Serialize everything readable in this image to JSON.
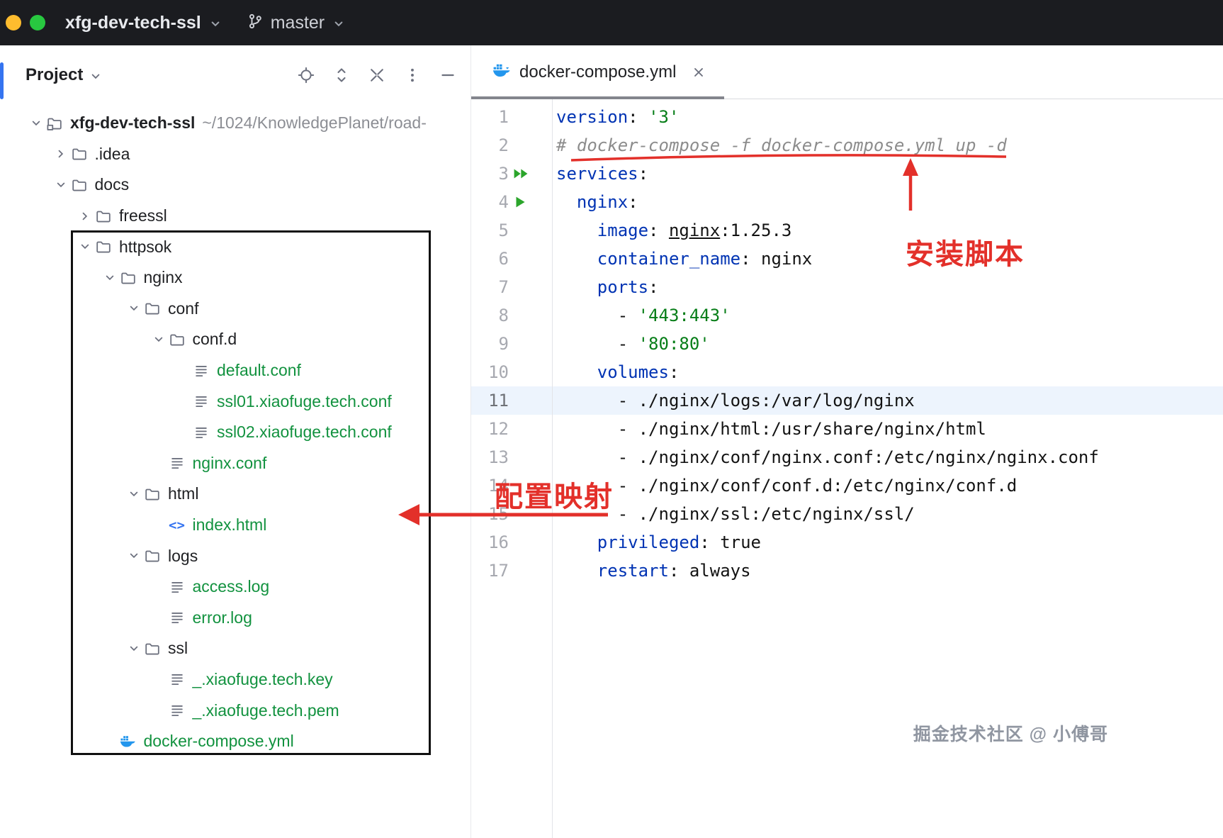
{
  "titlebar": {
    "project_name": "xfg-dev-tech-ssl",
    "branch": "master"
  },
  "project_panel": {
    "title": "Project",
    "tree": [
      {
        "label": "xfg-dev-tech-ssl",
        "suffix": " ~/1024/KnowledgePlanet/road-",
        "indent": 0,
        "icon": "project_folder",
        "chevron": "down",
        "color": "dark",
        "bold": true
      },
      {
        "label": ".idea",
        "indent": 1,
        "icon": "folder",
        "chevron": "right",
        "color": "dark"
      },
      {
        "label": "docs",
        "indent": 1,
        "icon": "folder",
        "chevron": "down",
        "color": "dark"
      },
      {
        "label": "freessl",
        "indent": 2,
        "icon": "folder",
        "chevron": "right",
        "color": "dark"
      },
      {
        "label": "httpsok",
        "indent": 2,
        "icon": "folder",
        "chevron": "down",
        "color": "dark"
      },
      {
        "label": "nginx",
        "indent": 3,
        "icon": "folder",
        "chevron": "down",
        "color": "dark"
      },
      {
        "label": "conf",
        "indent": 4,
        "icon": "folder",
        "chevron": "down",
        "color": "dark"
      },
      {
        "label": "conf.d",
        "indent": 5,
        "icon": "folder",
        "chevron": "down",
        "color": "dark"
      },
      {
        "label": "default.conf",
        "indent": 6,
        "icon": "file",
        "chevron": "none",
        "color": "green"
      },
      {
        "label": "ssl01.xiaofuge.tech.conf",
        "indent": 6,
        "icon": "file",
        "chevron": "none",
        "color": "green"
      },
      {
        "label": "ssl02.xiaofuge.tech.conf",
        "indent": 6,
        "icon": "file",
        "chevron": "none",
        "color": "green"
      },
      {
        "label": "nginx.conf",
        "indent": 5,
        "icon": "file",
        "chevron": "none",
        "color": "green"
      },
      {
        "label": "html",
        "indent": 4,
        "icon": "folder",
        "chevron": "down",
        "color": "dark"
      },
      {
        "label": "index.html",
        "indent": 5,
        "icon": "html",
        "chevron": "none",
        "color": "green"
      },
      {
        "label": "logs",
        "indent": 4,
        "icon": "folder",
        "chevron": "down",
        "color": "dark"
      },
      {
        "label": "access.log",
        "indent": 5,
        "icon": "file",
        "chevron": "none",
        "color": "green"
      },
      {
        "label": "error.log",
        "indent": 5,
        "icon": "file",
        "chevron": "none",
        "color": "green"
      },
      {
        "label": "ssl",
        "indent": 4,
        "icon": "folder",
        "chevron": "down",
        "color": "dark"
      },
      {
        "label": "_.xiaofuge.tech.key",
        "indent": 5,
        "icon": "file",
        "chevron": "none",
        "color": "green"
      },
      {
        "label": "_.xiaofuge.tech.pem",
        "indent": 5,
        "icon": "file",
        "chevron": "none",
        "color": "green"
      },
      {
        "label": "docker-compose.yml",
        "indent": 3,
        "icon": "docker",
        "chevron": "none",
        "color": "green"
      }
    ]
  },
  "editor": {
    "tab": {
      "title": "docker-compose.yml"
    },
    "lines": [
      {
        "n": 1,
        "tokens": [
          {
            "t": "version",
            "c": "key"
          },
          {
            "t": ": ",
            "c": "p"
          },
          {
            "t": "'3'",
            "c": "str"
          }
        ]
      },
      {
        "n": 2,
        "tokens": [
          {
            "t": "# docker-compose -f docker-compose.yml up -d",
            "c": "com"
          }
        ]
      },
      {
        "n": 3,
        "run": "double",
        "tokens": [
          {
            "t": "services",
            "c": "key"
          },
          {
            "t": ":",
            "c": "p"
          }
        ]
      },
      {
        "n": 4,
        "run": "single",
        "tokens": [
          {
            "t": "  ",
            "c": "p"
          },
          {
            "t": "nginx",
            "c": "key"
          },
          {
            "t": ":",
            "c": "p"
          }
        ]
      },
      {
        "n": 5,
        "tokens": [
          {
            "t": "    ",
            "c": "p"
          },
          {
            "t": "image",
            "c": "key"
          },
          {
            "t": ": ",
            "c": "p"
          },
          {
            "t": "nginx",
            "c": "txt u"
          },
          {
            "t": ":1.25.3",
            "c": "txt"
          }
        ]
      },
      {
        "n": 6,
        "tokens": [
          {
            "t": "    ",
            "c": "p"
          },
          {
            "t": "container_name",
            "c": "key"
          },
          {
            "t": ": ",
            "c": "p"
          },
          {
            "t": "nginx",
            "c": "txt"
          }
        ]
      },
      {
        "n": 7,
        "tokens": [
          {
            "t": "    ",
            "c": "p"
          },
          {
            "t": "ports",
            "c": "key"
          },
          {
            "t": ":",
            "c": "p"
          }
        ]
      },
      {
        "n": 8,
        "tokens": [
          {
            "t": "      - ",
            "c": "p"
          },
          {
            "t": "'443:443'",
            "c": "str"
          }
        ]
      },
      {
        "n": 9,
        "tokens": [
          {
            "t": "      - ",
            "c": "p"
          },
          {
            "t": "'80:80'",
            "c": "str"
          }
        ]
      },
      {
        "n": 10,
        "tokens": [
          {
            "t": "    ",
            "c": "p"
          },
          {
            "t": "volumes",
            "c": "key"
          },
          {
            "t": ":",
            "c": "p"
          }
        ]
      },
      {
        "n": 11,
        "hl": true,
        "tokens": [
          {
            "t": "      - ./nginx/logs:/var/log/nginx",
            "c": "txt"
          }
        ]
      },
      {
        "n": 12,
        "tokens": [
          {
            "t": "      - ./nginx/html:/usr/share/nginx/html",
            "c": "txt"
          }
        ]
      },
      {
        "n": 13,
        "tokens": [
          {
            "t": "      - ./nginx/conf/nginx.conf:/etc/nginx/nginx.conf",
            "c": "txt"
          }
        ]
      },
      {
        "n": 14,
        "tokens": [
          {
            "t": "      - ./nginx/conf/conf.d:/etc/nginx/conf.d",
            "c": "txt"
          }
        ]
      },
      {
        "n": 15,
        "tokens": [
          {
            "t": "      - ./nginx/ssl:/etc/nginx/ssl/",
            "c": "txt"
          }
        ]
      },
      {
        "n": 16,
        "tokens": [
          {
            "t": "    ",
            "c": "p"
          },
          {
            "t": "privileged",
            "c": "key"
          },
          {
            "t": ": ",
            "c": "p"
          },
          {
            "t": "true",
            "c": "txt"
          }
        ]
      },
      {
        "n": 17,
        "tokens": [
          {
            "t": "    ",
            "c": "p"
          },
          {
            "t": "restart",
            "c": "key"
          },
          {
            "t": ": ",
            "c": "p"
          },
          {
            "t": "always",
            "c": "txt"
          }
        ]
      }
    ]
  },
  "annotations": {
    "install_label": "安装脚本",
    "mapping_label": "配置映射"
  },
  "watermark": "掘金技术社区 @ 小傅哥",
  "colors": {
    "annotation_red": "#e3302a",
    "vcs_added_green": "#12923f",
    "yaml_key": "#0033b3",
    "yaml_string": "#067d17",
    "comment_gray": "#8c8c8c",
    "accent_blue": "#3574f0"
  }
}
